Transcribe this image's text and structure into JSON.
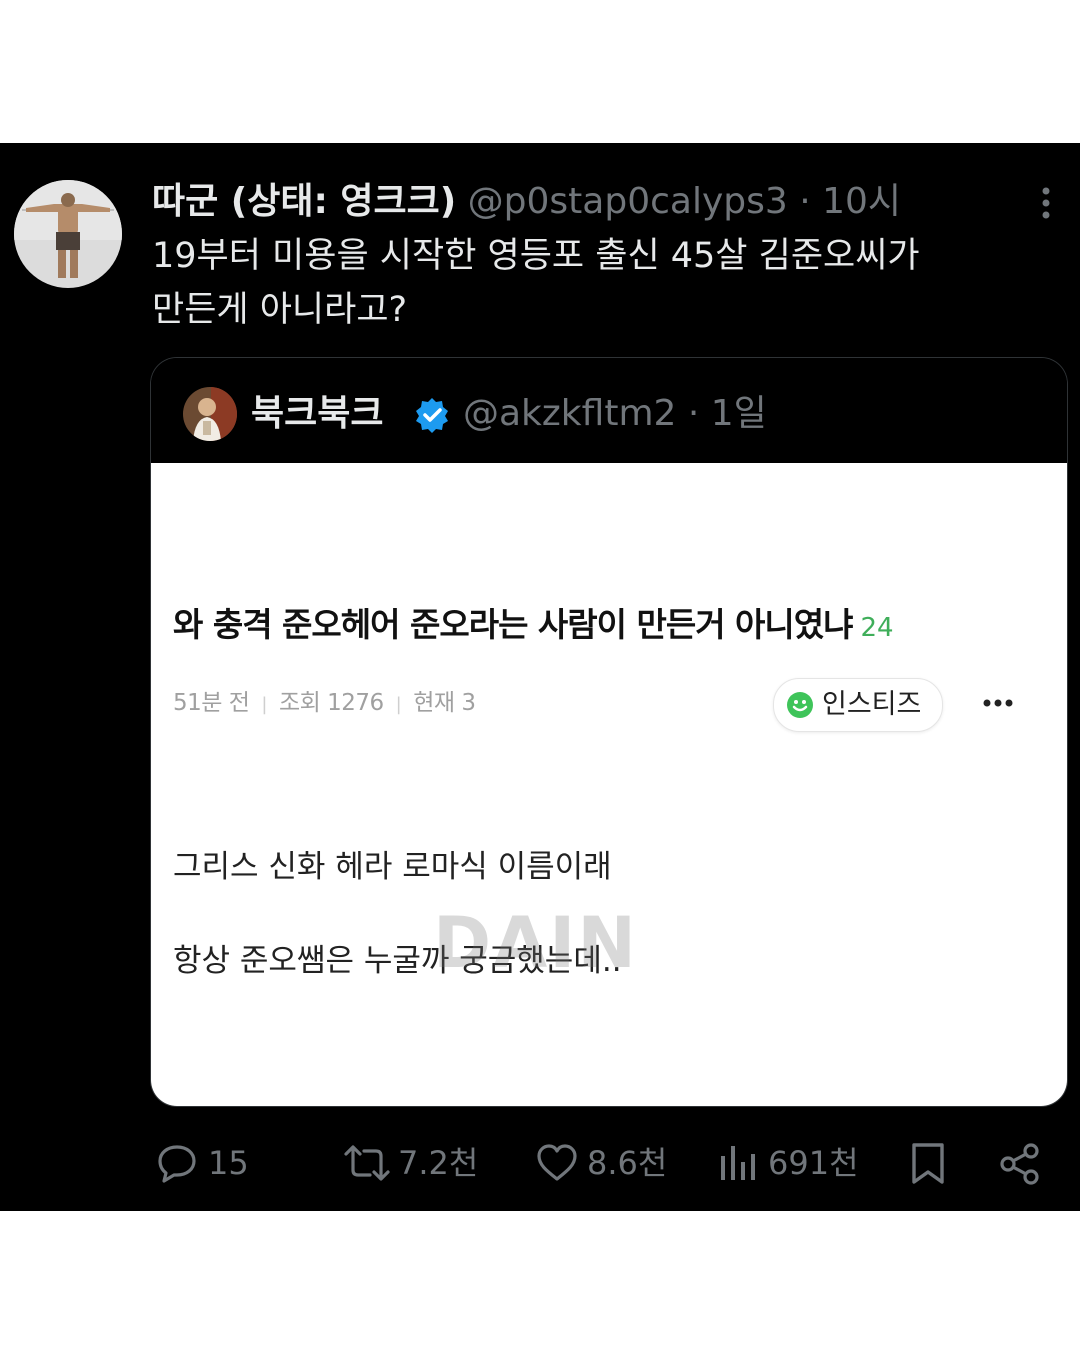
{
  "tweet": {
    "display_name": "따군 (상태: 영크크)",
    "handle_time": "@p0stap0calyps3 · 10시",
    "text_lines": [
      "19부터 미용을 시작한 영등포 출신 45살 김준오씨가",
      "만든게 아니라고?"
    ]
  },
  "quote": {
    "display_name": "북크북크",
    "handle_time": "@akzkfltm2 · 1일",
    "screenshot": {
      "title": "와 충격 준오헤어 준오라는 사람이 만든거 아니였냐",
      "comment_count": "24",
      "meta": {
        "time": "51분 전",
        "views": "조회 1276",
        "current": "현재 3"
      },
      "source_label": "인스티즈",
      "body_lines": [
        "그리스 신화 헤라 로마식 이름이래",
        "항상 준오쌤은 누굴까 궁금했는데.."
      ],
      "watermark": "DAIN"
    }
  },
  "actions": {
    "replies": "15",
    "reposts": "7.2천",
    "likes": "8.6천",
    "views": "691천"
  },
  "icons": {
    "more": "more-vertical-icon",
    "verified": "verified-badge-icon",
    "reply": "reply-icon",
    "repost": "repost-icon",
    "like": "heart-icon",
    "views": "views-chart-icon",
    "bookmark": "bookmark-icon",
    "share": "share-icon"
  },
  "colors": {
    "background": "#000000",
    "text": "#e7e9ea",
    "muted": "#71767b",
    "verified": "#1d9bf0",
    "counter_green": "#3fae5a"
  }
}
